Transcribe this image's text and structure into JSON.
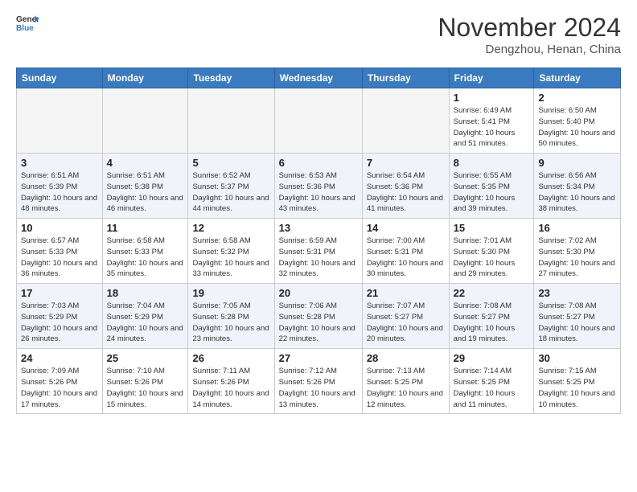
{
  "header": {
    "logo_line1": "General",
    "logo_line2": "Blue",
    "month_year": "November 2024",
    "location": "Dengzhou, Henan, China"
  },
  "weekdays": [
    "Sunday",
    "Monday",
    "Tuesday",
    "Wednesday",
    "Thursday",
    "Friday",
    "Saturday"
  ],
  "weeks": [
    [
      {
        "day": "",
        "info": ""
      },
      {
        "day": "",
        "info": ""
      },
      {
        "day": "",
        "info": ""
      },
      {
        "day": "",
        "info": ""
      },
      {
        "day": "",
        "info": ""
      },
      {
        "day": "1",
        "info": "Sunrise: 6:49 AM\nSunset: 5:41 PM\nDaylight: 10 hours and 51 minutes."
      },
      {
        "day": "2",
        "info": "Sunrise: 6:50 AM\nSunset: 5:40 PM\nDaylight: 10 hours and 50 minutes."
      }
    ],
    [
      {
        "day": "3",
        "info": "Sunrise: 6:51 AM\nSunset: 5:39 PM\nDaylight: 10 hours and 48 minutes."
      },
      {
        "day": "4",
        "info": "Sunrise: 6:51 AM\nSunset: 5:38 PM\nDaylight: 10 hours and 46 minutes."
      },
      {
        "day": "5",
        "info": "Sunrise: 6:52 AM\nSunset: 5:37 PM\nDaylight: 10 hours and 44 minutes."
      },
      {
        "day": "6",
        "info": "Sunrise: 6:53 AM\nSunset: 5:36 PM\nDaylight: 10 hours and 43 minutes."
      },
      {
        "day": "7",
        "info": "Sunrise: 6:54 AM\nSunset: 5:36 PM\nDaylight: 10 hours and 41 minutes."
      },
      {
        "day": "8",
        "info": "Sunrise: 6:55 AM\nSunset: 5:35 PM\nDaylight: 10 hours and 39 minutes."
      },
      {
        "day": "9",
        "info": "Sunrise: 6:56 AM\nSunset: 5:34 PM\nDaylight: 10 hours and 38 minutes."
      }
    ],
    [
      {
        "day": "10",
        "info": "Sunrise: 6:57 AM\nSunset: 5:33 PM\nDaylight: 10 hours and 36 minutes."
      },
      {
        "day": "11",
        "info": "Sunrise: 6:58 AM\nSunset: 5:33 PM\nDaylight: 10 hours and 35 minutes."
      },
      {
        "day": "12",
        "info": "Sunrise: 6:58 AM\nSunset: 5:32 PM\nDaylight: 10 hours and 33 minutes."
      },
      {
        "day": "13",
        "info": "Sunrise: 6:59 AM\nSunset: 5:31 PM\nDaylight: 10 hours and 32 minutes."
      },
      {
        "day": "14",
        "info": "Sunrise: 7:00 AM\nSunset: 5:31 PM\nDaylight: 10 hours and 30 minutes."
      },
      {
        "day": "15",
        "info": "Sunrise: 7:01 AM\nSunset: 5:30 PM\nDaylight: 10 hours and 29 minutes."
      },
      {
        "day": "16",
        "info": "Sunrise: 7:02 AM\nSunset: 5:30 PM\nDaylight: 10 hours and 27 minutes."
      }
    ],
    [
      {
        "day": "17",
        "info": "Sunrise: 7:03 AM\nSunset: 5:29 PM\nDaylight: 10 hours and 26 minutes."
      },
      {
        "day": "18",
        "info": "Sunrise: 7:04 AM\nSunset: 5:29 PM\nDaylight: 10 hours and 24 minutes."
      },
      {
        "day": "19",
        "info": "Sunrise: 7:05 AM\nSunset: 5:28 PM\nDaylight: 10 hours and 23 minutes."
      },
      {
        "day": "20",
        "info": "Sunrise: 7:06 AM\nSunset: 5:28 PM\nDaylight: 10 hours and 22 minutes."
      },
      {
        "day": "21",
        "info": "Sunrise: 7:07 AM\nSunset: 5:27 PM\nDaylight: 10 hours and 20 minutes."
      },
      {
        "day": "22",
        "info": "Sunrise: 7:08 AM\nSunset: 5:27 PM\nDaylight: 10 hours and 19 minutes."
      },
      {
        "day": "23",
        "info": "Sunrise: 7:08 AM\nSunset: 5:27 PM\nDaylight: 10 hours and 18 minutes."
      }
    ],
    [
      {
        "day": "24",
        "info": "Sunrise: 7:09 AM\nSunset: 5:26 PM\nDaylight: 10 hours and 17 minutes."
      },
      {
        "day": "25",
        "info": "Sunrise: 7:10 AM\nSunset: 5:26 PM\nDaylight: 10 hours and 15 minutes."
      },
      {
        "day": "26",
        "info": "Sunrise: 7:11 AM\nSunset: 5:26 PM\nDaylight: 10 hours and 14 minutes."
      },
      {
        "day": "27",
        "info": "Sunrise: 7:12 AM\nSunset: 5:26 PM\nDaylight: 10 hours and 13 minutes."
      },
      {
        "day": "28",
        "info": "Sunrise: 7:13 AM\nSunset: 5:25 PM\nDaylight: 10 hours and 12 minutes."
      },
      {
        "day": "29",
        "info": "Sunrise: 7:14 AM\nSunset: 5:25 PM\nDaylight: 10 hours and 11 minutes."
      },
      {
        "day": "30",
        "info": "Sunrise: 7:15 AM\nSunset: 5:25 PM\nDaylight: 10 hours and 10 minutes."
      }
    ]
  ]
}
